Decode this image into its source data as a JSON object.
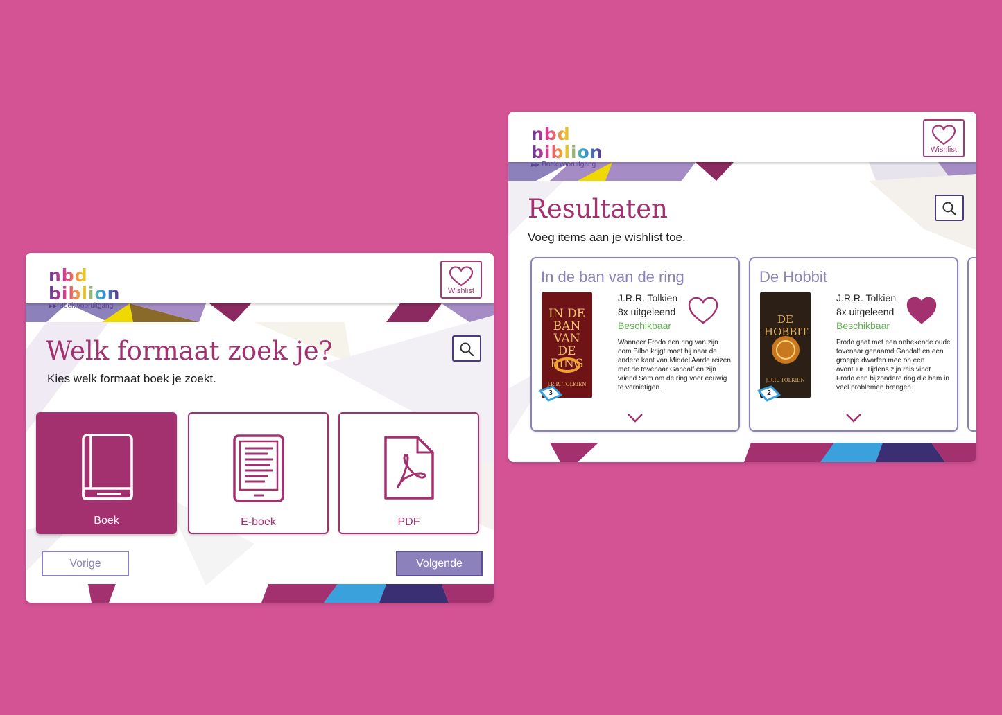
{
  "colors": {
    "background": "#d35395",
    "brand_magenta": "#a3316f",
    "brand_purple": "#8d81bb",
    "available_green": "#5fb24f"
  },
  "brand": {
    "logo_text": "nbd biblion",
    "tagline": "Boek vooruitgang"
  },
  "format_screen": {
    "wishlist_label": "Wishlist",
    "title": "Welk formaat zoek je?",
    "subtitle": "Kies welk formaat boek je zoekt.",
    "search_icon": "search-icon",
    "options": [
      {
        "label": "Boek",
        "icon": "book-icon",
        "selected": true
      },
      {
        "label": "E-boek",
        "icon": "ereader-icon",
        "selected": false
      },
      {
        "label": "PDF",
        "icon": "pdf-file-icon",
        "selected": false
      }
    ],
    "prev_label": "Vorige",
    "next_label": "Volgende"
  },
  "results_screen": {
    "wishlist_label": "Wishlist",
    "title": "Resultaten",
    "subtitle": "Voeg items aan je wishlist toe.",
    "search_icon": "search-icon",
    "books": [
      {
        "title": "In de ban van de ring",
        "cover_title": "IN DE BAN VAN DE RING",
        "cover_author": "J.R.R. TOLKIEN",
        "author": "J.R.R. Tolkien",
        "loans": "8x uitgeleend",
        "status": "Beschikbaar",
        "badge": "3",
        "wishlisted": false,
        "description": "Wanneer Frodo een ring van zijn oom Bilbo krijgt moet hij naar de andere kant van Middel Aarde reizen met de tovenaar Gandalf en zijn vriend Sam om de ring voor eeuwig te vernietigen."
      },
      {
        "title": "De Hobbit",
        "cover_title": "DE HOBBIT",
        "cover_author": "J.R.R. TOLKIEN",
        "author": "J.R.R. Tolkien",
        "loans": "8x uitgeleend",
        "status": "Beschikbaar",
        "badge": "2",
        "wishlisted": true,
        "description": "Frodo gaat met een onbekende oude tovenaar genaamd Gandalf en een groepje dwarfen mee op een avontuur. Tijdens zijn reis vindt Frodo een bijzondere ring die hem in veel problemen brengen."
      }
    ]
  }
}
